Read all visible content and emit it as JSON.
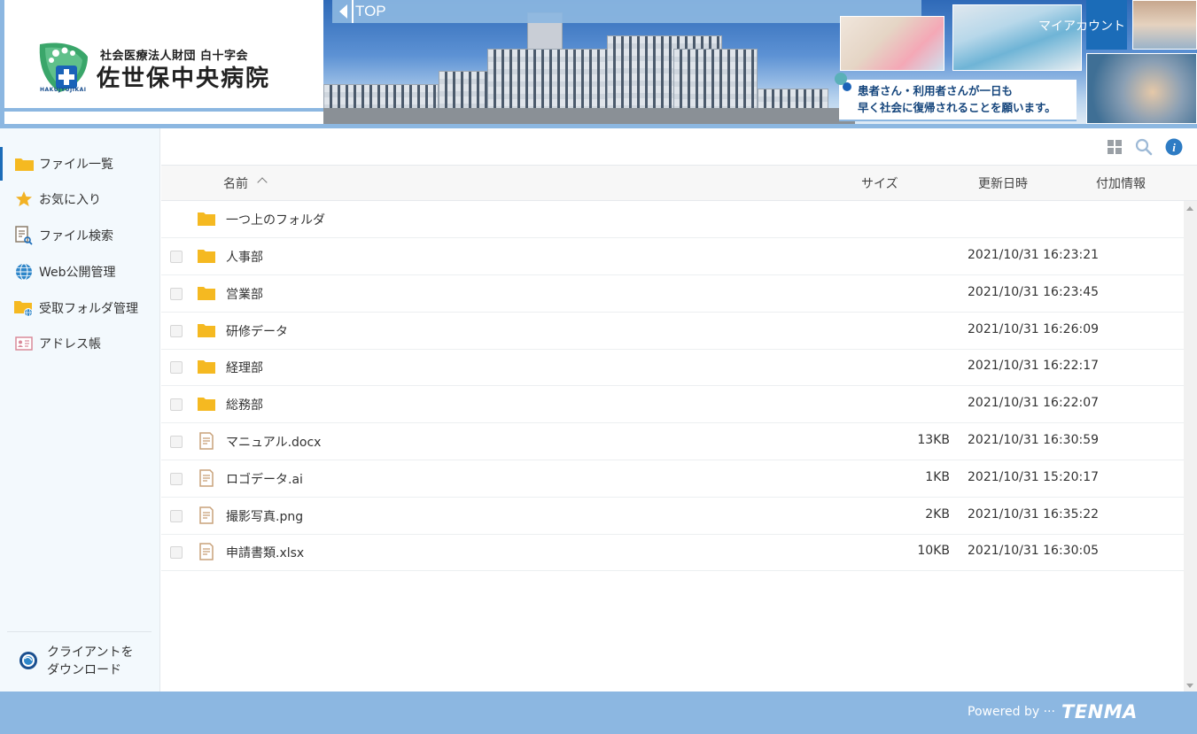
{
  "header": {
    "org_sub": "社会医療法人財団 白十字会",
    "org_name": "佐世保中央病院",
    "org_roman": "HAKUJYUJIKAI",
    "top_label": "TOP",
    "tagline_1": "患者さん・利用者さんが一日も",
    "tagline_2": "早く社会に復帰されることを願います。",
    "my_account": "マイアカウント"
  },
  "sidebar": {
    "items": [
      {
        "label": "ファイル一覧",
        "icon": "folder-icon",
        "active": true
      },
      {
        "label": "お気に入り",
        "icon": "star-icon"
      },
      {
        "label": "ファイル検索",
        "icon": "file-search-icon"
      },
      {
        "label": "Web公開管理",
        "icon": "globe-icon"
      },
      {
        "label": "受取フォルダ管理",
        "icon": "folder-globe-icon"
      },
      {
        "label": "アドレス帳",
        "icon": "address-book-icon"
      }
    ],
    "client_line1": "クライアントを",
    "client_line2": "ダウンロード"
  },
  "toolbar": {
    "icons": [
      "grid-view-icon",
      "search-icon",
      "info-icon"
    ]
  },
  "table": {
    "columns": {
      "name": "名前",
      "size": "サイズ",
      "date": "更新日時",
      "extra": "付加情報"
    },
    "parent_folder": "一つ上のフォルダ",
    "rows": [
      {
        "name": "人事部",
        "type": "folder",
        "size": "",
        "date": "2021/10/31 16:23:21"
      },
      {
        "name": "営業部",
        "type": "folder",
        "size": "",
        "date": "2021/10/31 16:23:45"
      },
      {
        "name": "研修データ",
        "type": "folder",
        "size": "",
        "date": "2021/10/31 16:26:09"
      },
      {
        "name": "経理部",
        "type": "folder",
        "size": "",
        "date": "2021/10/31 16:22:17"
      },
      {
        "name": "総務部",
        "type": "folder",
        "size": "",
        "date": "2021/10/31 16:22:07"
      },
      {
        "name": "マニュアル.docx",
        "type": "file",
        "size": "13KB",
        "date": "2021/10/31 16:30:59"
      },
      {
        "name": "ロゴデータ.ai",
        "type": "file",
        "size": "1KB",
        "date": "2021/10/31 15:20:17"
      },
      {
        "name": "撮影写真.png",
        "type": "file",
        "size": "2KB",
        "date": "2021/10/31 16:35:22"
      },
      {
        "name": "申請書類.xlsx",
        "type": "file",
        "size": "10KB",
        "date": "2021/10/31 16:30:05"
      }
    ]
  },
  "footer": {
    "powered_by": "Powered by ···",
    "brand": "TENMA"
  },
  "colors": {
    "accent_blue": "#8cb7e1",
    "active_blue": "#1b6cb8",
    "folder_yellow": "#f5b921",
    "file_tan": "#c9a27a"
  }
}
